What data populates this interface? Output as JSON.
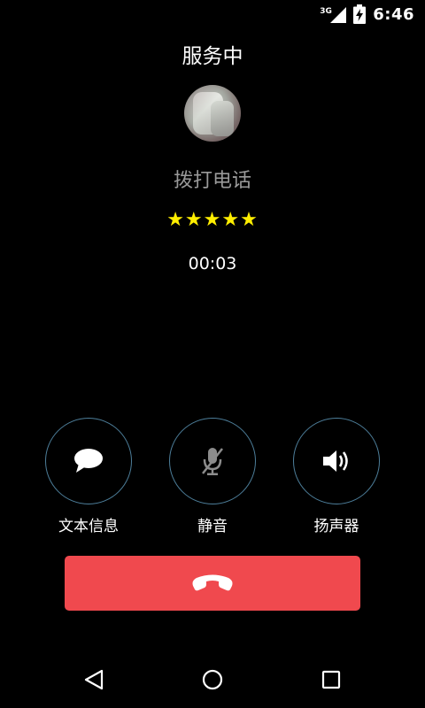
{
  "status_bar": {
    "network_type": "3G",
    "time": "6:46",
    "icons": [
      "signal-icon",
      "battery-charging-icon"
    ]
  },
  "call": {
    "state": "服务中",
    "caller_name": "拨打电话",
    "stars": "★★★★★",
    "duration": "00:03"
  },
  "actions": [
    {
      "icon": "message-icon",
      "label": "文本信息"
    },
    {
      "icon": "mute-mic-icon",
      "label": "静音"
    },
    {
      "icon": "speaker-icon",
      "label": "扬声器"
    }
  ],
  "end_call": {
    "icon": "hang-up-icon",
    "color": "#f0494e"
  },
  "nav": {
    "icons": [
      "back-icon",
      "home-icon",
      "recent-apps-icon"
    ]
  },
  "colors": {
    "background": "#000000",
    "caller_name": "#9a9a9a",
    "stars": "#ffee00",
    "action_ring": "#4d7e9a",
    "end_call": "#f0494e"
  }
}
